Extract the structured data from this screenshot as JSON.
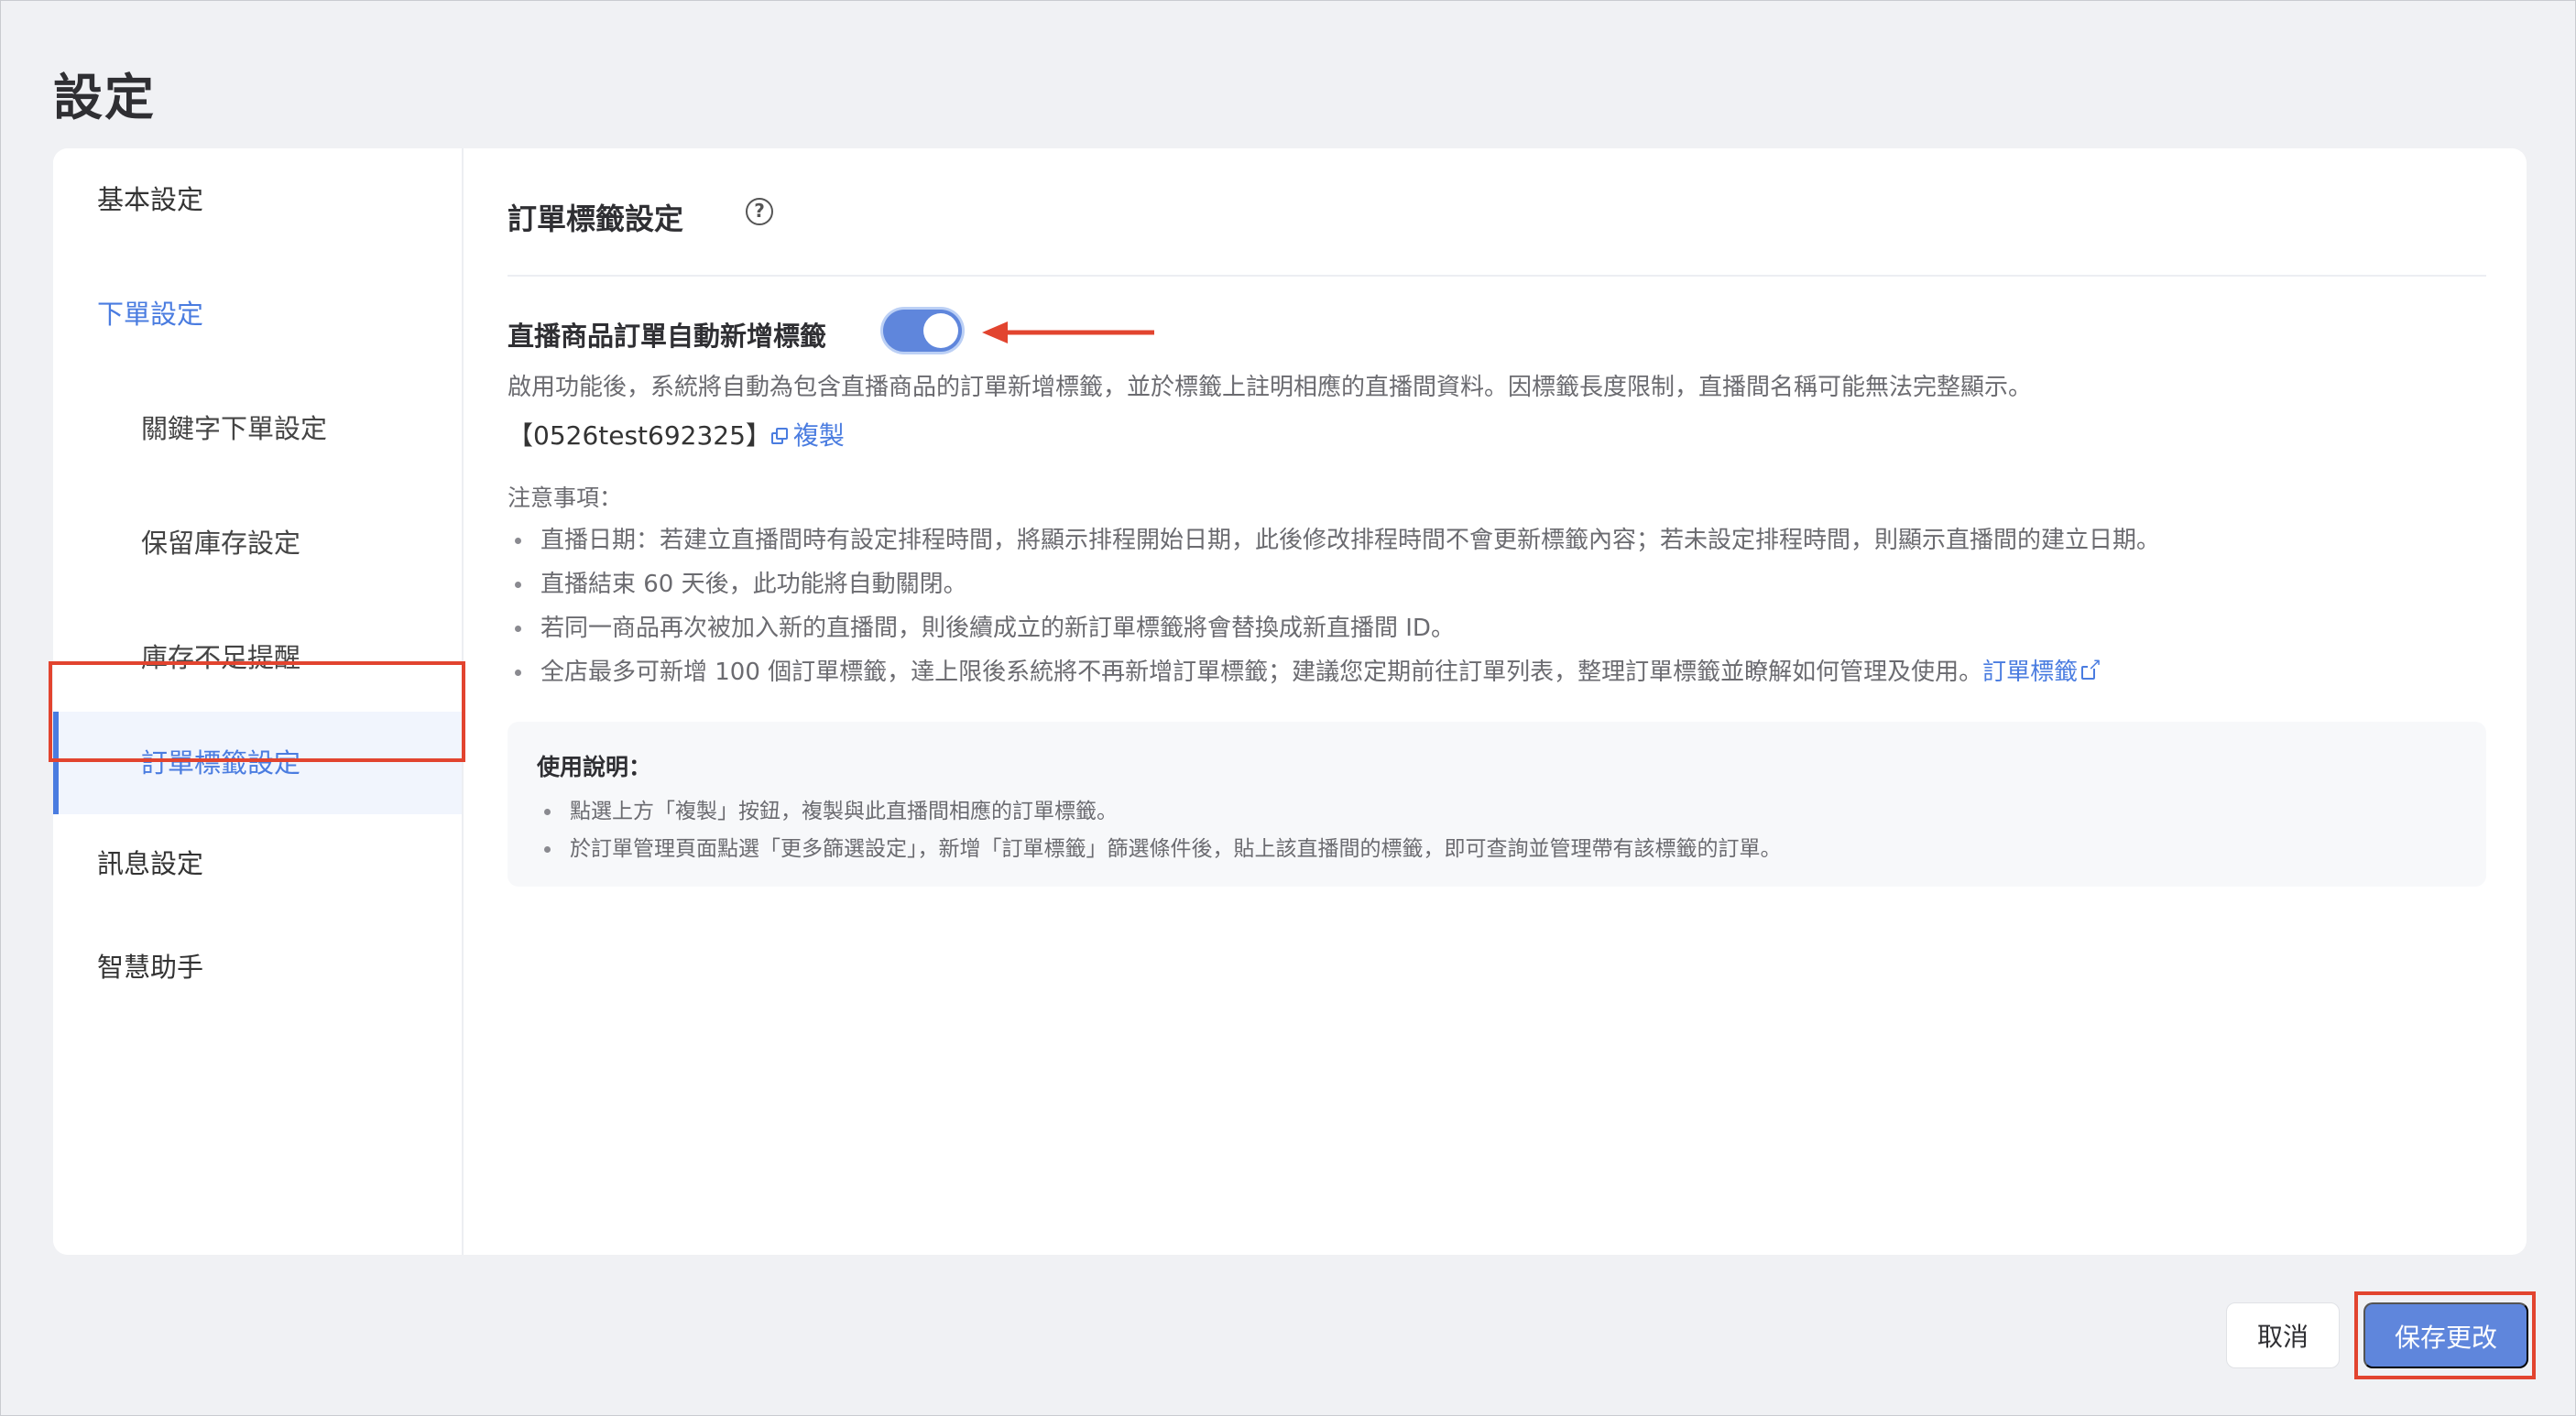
{
  "page": {
    "title": "設定"
  },
  "sidebar": {
    "items": [
      {
        "label": "基本設定"
      },
      {
        "label": "下單設定"
      },
      {
        "label": "關鍵字下單設定"
      },
      {
        "label": "保留庫存設定"
      },
      {
        "label": "庫存不足提醒"
      },
      {
        "label": "訂單標籤設定"
      },
      {
        "label": "訊息設定"
      },
      {
        "label": "智慧助手"
      }
    ],
    "active_label": "訂單標籤設定"
  },
  "section": {
    "title": "訂單標籤設定",
    "help_icon": "?"
  },
  "toggle": {
    "label": "直播商品訂單自動新增標籤",
    "state": "on"
  },
  "description": "啟用功能後，系統將自動為包含直播商品的訂單新增標籤，並於標籤上註明相應的直播間資料。因標籤長度限制，直播間名稱可能無法完整顯示。",
  "tag": {
    "value": "【0526test692325】",
    "copy_label": "複製"
  },
  "notes": {
    "title": "注意事項：",
    "items": [
      "直播日期：若建立直播間時有設定排程時間，將顯示排程開始日期，此後修改排程時間不會更新標籤內容；若未設定排程時間，則顯示直播間的建立日期。",
      "直播結束 60 天後，此功能將自動關閉。",
      "若同一商品再次被加入新的直播間，則後續成立的新訂單標籤將會替換成新直播間 ID。",
      "全店最多可新增 100 個訂單標籤，達上限後系統將不再新增訂單標籤；建議您定期前往訂單列表，整理訂單標籤並瞭解如何管理及使用。"
    ],
    "link_label": "訂單標籤"
  },
  "usage": {
    "title": "使用說明：",
    "items": [
      "點選上方「複製」按鈕，複製與此直播間相應的訂單標籤。",
      "於訂單管理頁面點選「更多篩選設定」，新增「訂單標籤」篩選條件後，貼上該直播間的標籤，即可查詢並管理帶有該標籤的訂單。"
    ]
  },
  "footer": {
    "cancel_label": "取消",
    "save_label": "保存更改"
  },
  "colors": {
    "accent": "#4a7ce0",
    "toggle_on": "#5f86dc",
    "highlight": "#e2442f"
  }
}
